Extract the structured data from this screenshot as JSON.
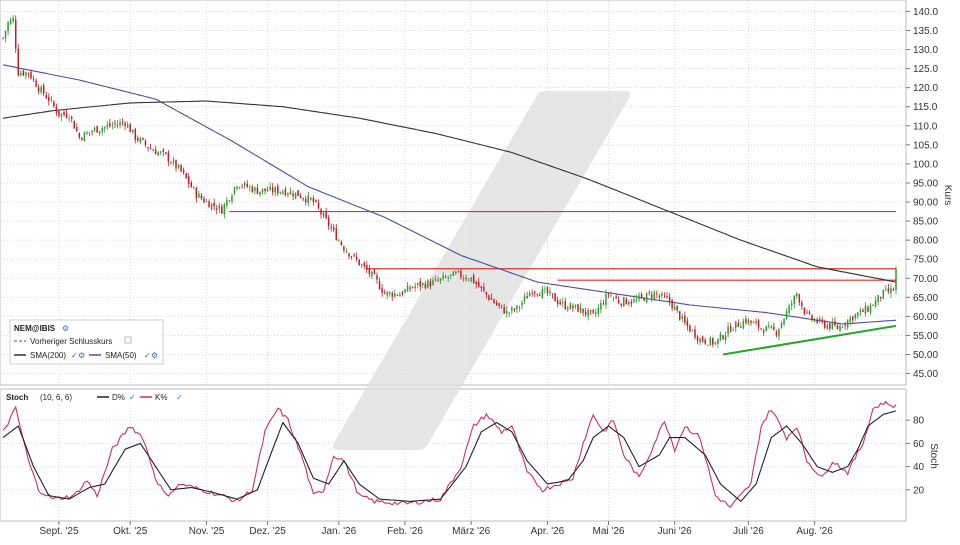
{
  "chart_data": [
    {
      "type": "candlestick",
      "panel": "price",
      "axis_label": "Kurs",
      "ylim": [
        42,
        143
      ],
      "yticks": [
        45,
        50,
        55,
        60,
        65,
        70,
        75,
        80,
        85,
        90,
        95,
        100,
        105,
        110,
        115,
        120,
        125,
        130,
        135,
        140
      ],
      "ytick_labels": [
        "45.00",
        "50.00",
        "55.00",
        "60.00",
        "65.00",
        "70.00",
        "75.00",
        "80.00",
        "85.00",
        "90.00",
        "95.00",
        "100.0",
        "105.0",
        "110.0",
        "115.0",
        "120.0",
        "125.0",
        "130.0",
        "135.0",
        "140.0"
      ],
      "grid": true,
      "anchors": [
        [
          0,
          133
        ],
        [
          2,
          137
        ],
        [
          4,
          138
        ],
        [
          6,
          124
        ],
        [
          10,
          124
        ],
        [
          14,
          120
        ],
        [
          18,
          117
        ],
        [
          22,
          113
        ],
        [
          26,
          113
        ],
        [
          30,
          107
        ],
        [
          36,
          109
        ],
        [
          42,
          110
        ],
        [
          48,
          111
        ],
        [
          52,
          107
        ],
        [
          58,
          104
        ],
        [
          64,
          102
        ],
        [
          70,
          98
        ],
        [
          76,
          92
        ],
        [
          80,
          90
        ],
        [
          86,
          88
        ],
        [
          92,
          95
        ],
        [
          100,
          93
        ],
        [
          110,
          93
        ],
        [
          116,
          92
        ],
        [
          122,
          90
        ],
        [
          128,
          84
        ],
        [
          134,
          78
        ],
        [
          140,
          74
        ],
        [
          146,
          70
        ],
        [
          150,
          66
        ],
        [
          156,
          66
        ],
        [
          162,
          68
        ],
        [
          170,
          69
        ],
        [
          178,
          71
        ],
        [
          184,
          70
        ],
        [
          188,
          67
        ],
        [
          194,
          63
        ],
        [
          198,
          61
        ],
        [
          202,
          62
        ],
        [
          208,
          67
        ],
        [
          214,
          66
        ],
        [
          220,
          63
        ],
        [
          226,
          62
        ],
        [
          232,
          60
        ],
        [
          238,
          66
        ],
        [
          242,
          64
        ],
        [
          248,
          64
        ],
        [
          252,
          65
        ],
        [
          256,
          66
        ],
        [
          262,
          64
        ],
        [
          268,
          58
        ],
        [
          274,
          54
        ],
        [
          280,
          53
        ],
        [
          286,
          57
        ],
        [
          292,
          59
        ],
        [
          298,
          57
        ],
        [
          304,
          56
        ],
        [
          308,
          61
        ],
        [
          312,
          66
        ],
        [
          316,
          60
        ],
        [
          322,
          58
        ],
        [
          328,
          57
        ],
        [
          334,
          60
        ],
        [
          340,
          62
        ],
        [
          346,
          66
        ],
        [
          350,
          67
        ],
        [
          351,
          72
        ]
      ],
      "sma_anchors": {
        "SMA(50)": [
          [
            0,
            126
          ],
          [
            30,
            122
          ],
          [
            60,
            117
          ],
          [
            90,
            106
          ],
          [
            120,
            94
          ],
          [
            150,
            86
          ],
          [
            180,
            76
          ],
          [
            210,
            69
          ],
          [
            240,
            66
          ],
          [
            270,
            63
          ],
          [
            300,
            61
          ],
          [
            330,
            58
          ],
          [
            351,
            59
          ]
        ],
        "SMA(200)": [
          [
            0,
            112
          ],
          [
            20,
            114
          ],
          [
            50,
            116
          ],
          [
            80,
            116.5
          ],
          [
            110,
            115
          ],
          [
            140,
            112
          ],
          [
            170,
            108
          ],
          [
            200,
            103
          ],
          [
            230,
            96
          ],
          [
            260,
            88
          ],
          [
            290,
            80
          ],
          [
            320,
            73
          ],
          [
            351,
            69
          ]
        ]
      },
      "hlines": [
        {
          "y": 87.5,
          "x_from": 89,
          "x_to": 351
        },
        {
          "y": 72.5,
          "x_from": 143,
          "x_to": 351
        },
        {
          "y": 69.5,
          "x_from": 218,
          "x_to": 351
        }
      ],
      "trendline": {
        "from": [
          283,
          50
        ],
        "to": [
          351,
          57.5
        ]
      },
      "legend": {
        "title": "NEM@IBIS",
        "items": [
          {
            "label": "Vorheriger Schlusskurs",
            "style": "dashed",
            "color": "#555555"
          },
          {
            "label": "SMA(200)",
            "style": "solid",
            "color": "#333333"
          },
          {
            "label": "SMA(50)",
            "style": "solid",
            "color": "#4e4e9e"
          }
        ]
      },
      "colors": {
        "up": "#2e9e33",
        "down": "#c41e2a",
        "hline": "#e03131",
        "trend": "#23a62a",
        "grid": "#d9d9d9"
      }
    },
    {
      "type": "line",
      "panel": "stochastic",
      "axis_label": "Stoch",
      "ylim": [
        0,
        100
      ],
      "yticks": [
        20,
        40,
        60,
        80
      ],
      "ytick_labels": [
        "20",
        "40",
        "60",
        "80"
      ],
      "grid": true,
      "header": {
        "title": "Stoch",
        "params": "(10, 6, 6)",
        "items": [
          "D%",
          "K%"
        ]
      },
      "series": [
        {
          "name": "K%",
          "color": "#cc3355",
          "anchors": [
            [
              0,
              70
            ],
            [
              5,
              90
            ],
            [
              10,
              45
            ],
            [
              14,
              20
            ],
            [
              20,
              12
            ],
            [
              28,
              15
            ],
            [
              33,
              28
            ],
            [
              37,
              15
            ],
            [
              43,
              55
            ],
            [
              50,
              75
            ],
            [
              55,
              65
            ],
            [
              60,
              30
            ],
            [
              64,
              15
            ],
            [
              70,
              25
            ],
            [
              78,
              20
            ],
            [
              86,
              15
            ],
            [
              92,
              10
            ],
            [
              98,
              20
            ],
            [
              103,
              70
            ],
            [
              108,
              90
            ],
            [
              112,
              80
            ],
            [
              118,
              45
            ],
            [
              122,
              15
            ],
            [
              126,
              20
            ],
            [
              130,
              50
            ],
            [
              134,
              45
            ],
            [
              140,
              15
            ],
            [
              146,
              10
            ],
            [
              158,
              8
            ],
            [
              172,
              12
            ],
            [
              180,
              40
            ],
            [
              185,
              75
            ],
            [
              190,
              85
            ],
            [
              196,
              70
            ],
            [
              200,
              75
            ],
            [
              206,
              35
            ],
            [
              212,
              20
            ],
            [
              218,
              25
            ],
            [
              224,
              30
            ],
            [
              228,
              60
            ],
            [
              232,
              85
            ],
            [
              236,
              70
            ],
            [
              240,
              80
            ],
            [
              244,
              50
            ],
            [
              250,
              30
            ],
            [
              256,
              60
            ],
            [
              260,
              80
            ],
            [
              264,
              55
            ],
            [
              268,
              75
            ],
            [
              274,
              65
            ],
            [
              280,
              15
            ],
            [
              286,
              5
            ],
            [
              294,
              25
            ],
            [
              298,
              75
            ],
            [
              302,
              90
            ],
            [
              308,
              65
            ],
            [
              312,
              75
            ],
            [
              316,
              45
            ],
            [
              322,
              30
            ],
            [
              326,
              45
            ],
            [
              332,
              35
            ],
            [
              338,
              60
            ],
            [
              342,
              90
            ],
            [
              346,
              95
            ],
            [
              351,
              92
            ]
          ]
        },
        {
          "name": "D%",
          "color": "#222222",
          "anchors": [
            [
              0,
              65
            ],
            [
              6,
              75
            ],
            [
              12,
              40
            ],
            [
              18,
              15
            ],
            [
              26,
              12
            ],
            [
              34,
              22
            ],
            [
              40,
              25
            ],
            [
              48,
              55
            ],
            [
              54,
              60
            ],
            [
              60,
              40
            ],
            [
              66,
              20
            ],
            [
              74,
              22
            ],
            [
              82,
              18
            ],
            [
              92,
              12
            ],
            [
              100,
              20
            ],
            [
              106,
              55
            ],
            [
              110,
              78
            ],
            [
              116,
              60
            ],
            [
              122,
              30
            ],
            [
              128,
              25
            ],
            [
              134,
              45
            ],
            [
              140,
              25
            ],
            [
              148,
              12
            ],
            [
              160,
              10
            ],
            [
              172,
              12
            ],
            [
              182,
              40
            ],
            [
              188,
              70
            ],
            [
              194,
              78
            ],
            [
              200,
              70
            ],
            [
              206,
              45
            ],
            [
              214,
              25
            ],
            [
              222,
              28
            ],
            [
              228,
              45
            ],
            [
              232,
              65
            ],
            [
              238,
              75
            ],
            [
              244,
              65
            ],
            [
              250,
              40
            ],
            [
              258,
              50
            ],
            [
              262,
              65
            ],
            [
              268,
              65
            ],
            [
              276,
              50
            ],
            [
              282,
              25
            ],
            [
              290,
              10
            ],
            [
              296,
              25
            ],
            [
              302,
              65
            ],
            [
              308,
              75
            ],
            [
              314,
              60
            ],
            [
              320,
              40
            ],
            [
              326,
              35
            ],
            [
              332,
              40
            ],
            [
              336,
              55
            ],
            [
              340,
              75
            ],
            [
              346,
              85
            ],
            [
              351,
              88
            ]
          ]
        }
      ]
    }
  ],
  "x_axis": {
    "n_bars": 352,
    "ticks": [
      {
        "i": 22,
        "label": "Sept. '25"
      },
      {
        "i": 50,
        "label": "Okt. '25"
      },
      {
        "i": 80,
        "label": "Nov. '25"
      },
      {
        "i": 104,
        "label": "Dez. '25"
      },
      {
        "i": 132,
        "label": "Jan. '26"
      },
      {
        "i": 158,
        "label": "Feb. '26"
      },
      {
        "i": 184,
        "label": "März '26"
      },
      {
        "i": 214,
        "label": "Apr. '26"
      },
      {
        "i": 238,
        "label": "Mai '26"
      },
      {
        "i": 264,
        "label": "Juni '26"
      },
      {
        "i": 293,
        "label": "Juli '26"
      },
      {
        "i": 319,
        "label": "Aug. '26"
      }
    ]
  }
}
